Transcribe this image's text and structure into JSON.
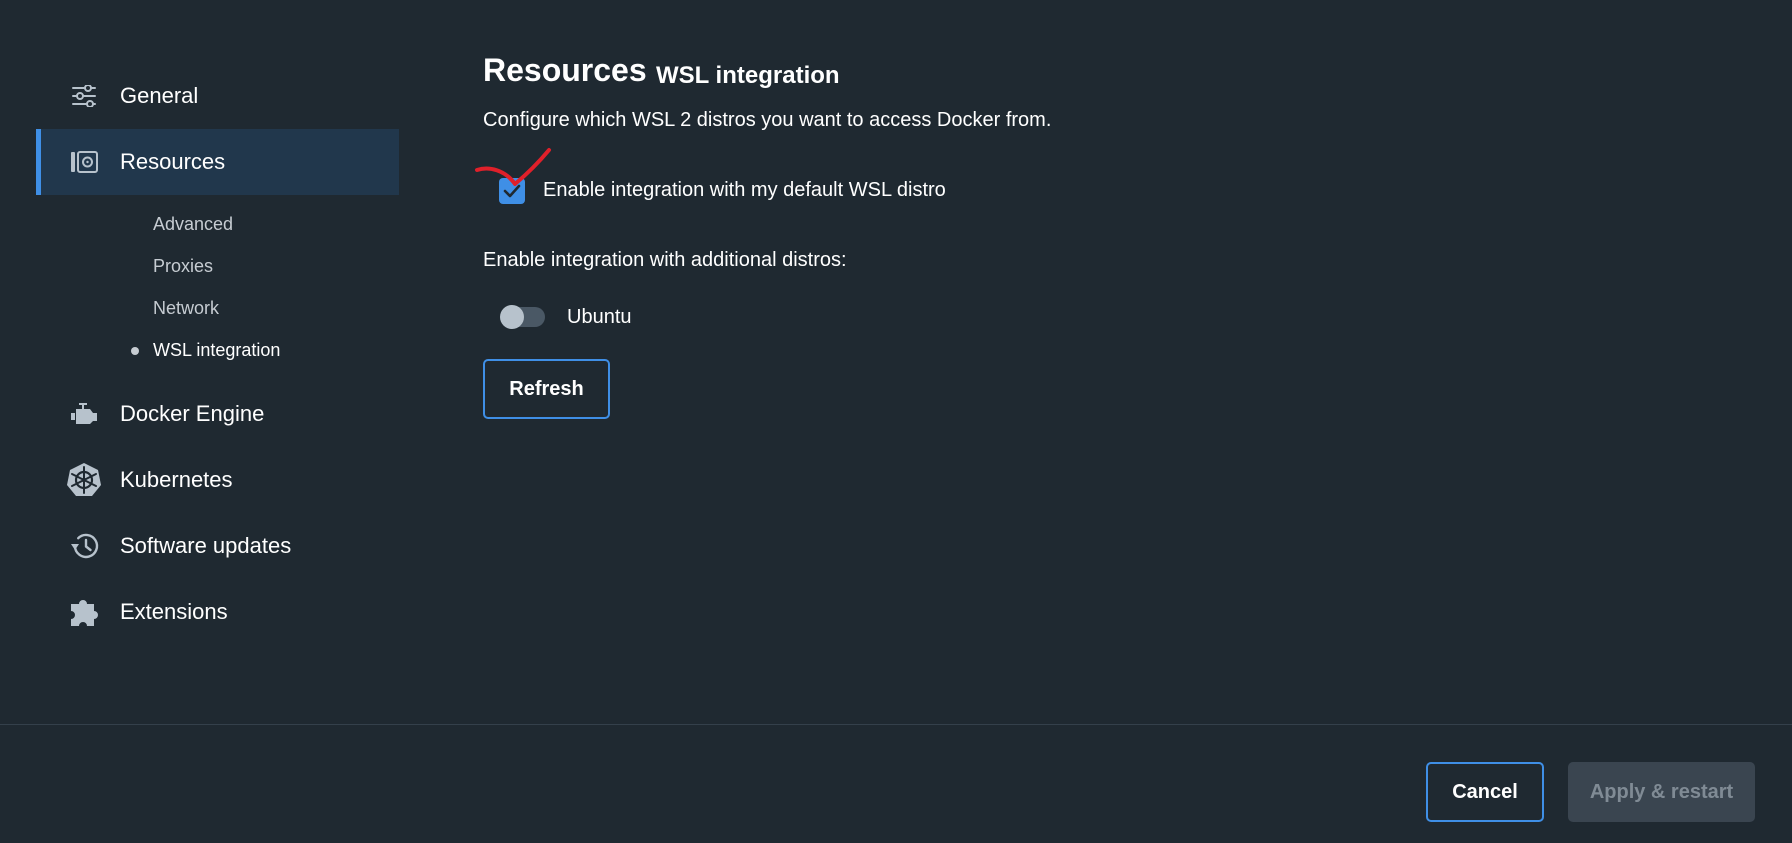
{
  "sidebar": {
    "items": [
      {
        "label": "General",
        "icon": "sliders-icon"
      },
      {
        "label": "Resources",
        "icon": "resources-icon",
        "active": true
      },
      {
        "label": "Docker Engine",
        "icon": "engine-icon"
      },
      {
        "label": "Kubernetes",
        "icon": "kubernetes-icon"
      },
      {
        "label": "Software updates",
        "icon": "history-icon"
      },
      {
        "label": "Extensions",
        "icon": "puzzle-icon"
      }
    ],
    "resources_subitems": [
      {
        "label": "Advanced"
      },
      {
        "label": "Proxies"
      },
      {
        "label": "Network"
      },
      {
        "label": "WSL integration",
        "current": true
      }
    ]
  },
  "main": {
    "title": "Resources",
    "subtitle": "WSL integration",
    "description": "Configure which WSL 2 distros you want to access Docker from.",
    "default_distro": {
      "label": "Enable integration with my default WSL distro",
      "checked": true
    },
    "additional_label": "Enable integration with additional distros:",
    "distros": [
      {
        "name": "Ubuntu",
        "enabled": false
      }
    ],
    "refresh_label": "Refresh"
  },
  "footer": {
    "cancel_label": "Cancel",
    "apply_label": "Apply & restart",
    "apply_enabled": false
  },
  "colors": {
    "background": "#1f2931",
    "accent": "#3f8fe6",
    "active_nav": "#21374c",
    "annotation": "#e0202a"
  }
}
